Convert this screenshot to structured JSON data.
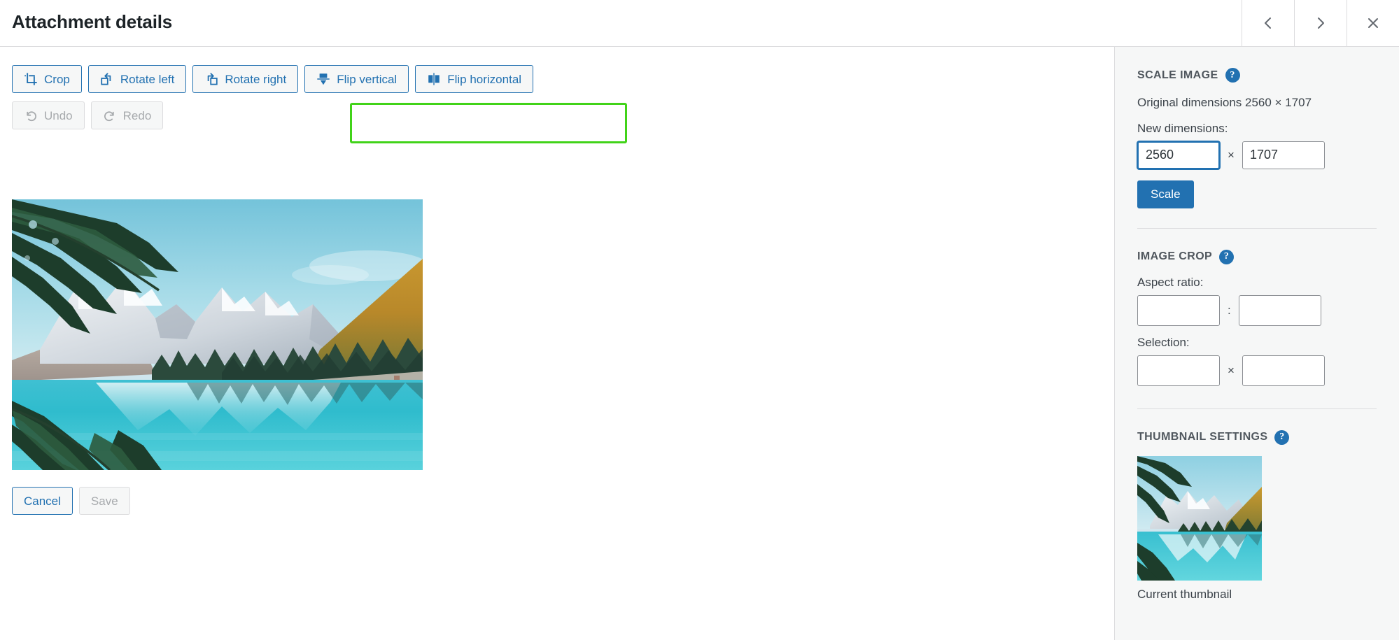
{
  "header": {
    "title": "Attachment details",
    "nav": {
      "prev_label": "Edit previous media item",
      "next_label": "Edit next media item",
      "close_label": "Close dialog"
    }
  },
  "toolbar": {
    "row1": [
      {
        "label": "Crop",
        "icon": "crop-icon",
        "disabled": false
      },
      {
        "label": "Rotate left",
        "icon": "rotate-left-icon",
        "disabled": false
      },
      {
        "label": "Rotate right",
        "icon": "rotate-right-icon",
        "disabled": false
      },
      {
        "label": "Flip vertical",
        "icon": "flip-vertical-icon",
        "disabled": false
      },
      {
        "label": "Flip horizontal",
        "icon": "flip-horizontal-icon",
        "disabled": false
      }
    ],
    "row2": [
      {
        "label": "Undo",
        "icon": "undo-icon",
        "disabled": true
      },
      {
        "label": "Redo",
        "icon": "redo-icon",
        "disabled": true
      }
    ],
    "highlight_color": "#41d319",
    "highlighted_buttons": [
      "Flip vertical",
      "Flip horizontal"
    ]
  },
  "actions": {
    "cancel_label": "Cancel",
    "save_label": "Save",
    "save_disabled": true
  },
  "preview": {
    "alt": "Moraine Lake with snow-capped mountains reflected in turquoise water, pine branches framing the left side"
  },
  "sidebar": {
    "scale_image": {
      "heading": "SCALE IMAGE",
      "help_glyph": "?",
      "original_dimensions_text": "Original dimensions 2560 × 1707",
      "new_dimensions_label": "New dimensions:",
      "width_value": "2560",
      "height_value": "1707",
      "dim_separator": "×",
      "scale_button_label": "Scale",
      "focused_field": "width"
    },
    "image_crop": {
      "heading": "IMAGE CROP",
      "help_glyph": "?",
      "aspect_ratio_label": "Aspect ratio:",
      "aspect_ratio_num": "",
      "aspect_ratio_den": "",
      "aspect_separator": ":",
      "selection_label": "Selection:",
      "selection_width": "",
      "selection_height": "",
      "selection_separator": "×"
    },
    "thumbnail_settings": {
      "heading": "THUMBNAIL SETTINGS",
      "help_glyph": "?",
      "thumbnail_caption": "Current thumbnail"
    }
  },
  "colors": {
    "accent": "#2271b1",
    "accent_hover": "#135e96",
    "sidebar_bg": "#f6f7f7",
    "border": "#dcdcde",
    "text": "#3c434a",
    "title": "#1d2327",
    "muted": "#a7aaad",
    "highlight": "#41d319"
  }
}
